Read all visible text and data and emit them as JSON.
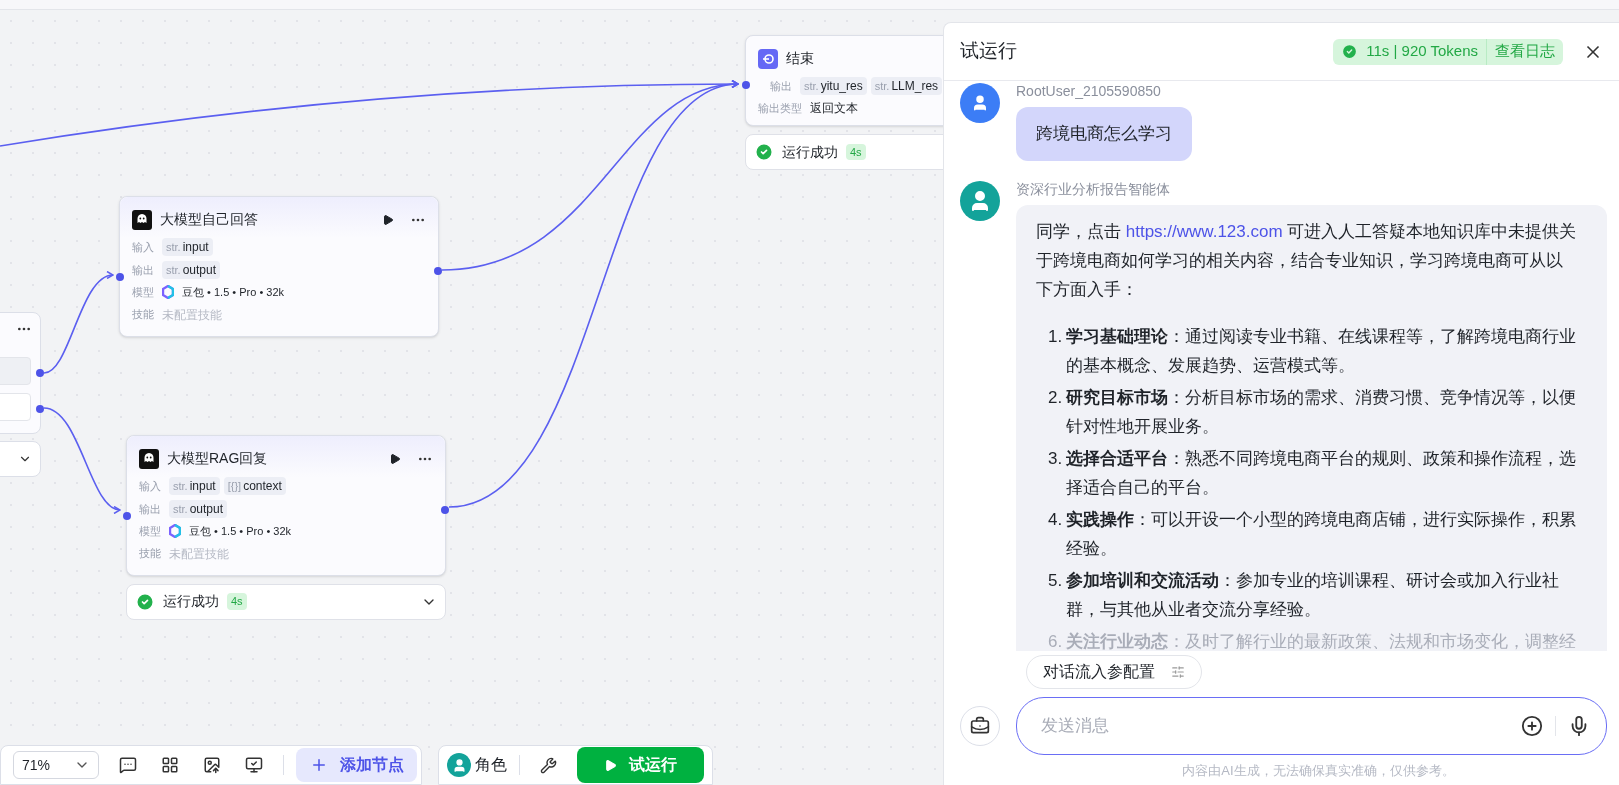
{
  "canvas": {
    "end_node": {
      "title": "结束",
      "output_label": "输出",
      "outputs": [
        {
          "type": "str.",
          "name": "yitu_res"
        },
        {
          "type": "str.",
          "name": "LLM_res"
        }
      ],
      "output_type_label": "输出类型",
      "output_type": "返回文本",
      "status": {
        "text": "运行成功",
        "time": "4s"
      }
    },
    "llm_nodes": [
      {
        "title": "大模型自己回答",
        "rows": [
          {
            "kind": "tags",
            "label": "输入",
            "tags": [
              {
                "type": "str.",
                "name": "input"
              }
            ]
          },
          {
            "kind": "tags",
            "label": "输出",
            "tags": [
              {
                "type": "str.",
                "name": "output"
              }
            ]
          },
          {
            "kind": "model",
            "label": "模型",
            "value": "豆包 • 1.5 • Pro • 32k"
          },
          {
            "kind": "muted",
            "label": "技能",
            "value": "未配置技能"
          }
        ]
      },
      {
        "title": "大模型RAG回复",
        "rows": [
          {
            "kind": "tags",
            "label": "输入",
            "tags": [
              {
                "type": "str.",
                "name": "input"
              },
              {
                "type": "[{}]",
                "name": "context"
              }
            ]
          },
          {
            "kind": "tags",
            "label": "输出",
            "tags": [
              {
                "type": "str.",
                "name": "output"
              }
            ]
          },
          {
            "kind": "model",
            "label": "模型",
            "value": "豆包 • 1.5 • Pro • 32k"
          },
          {
            "kind": "muted",
            "label": "技能",
            "value": "未配置技能"
          }
        ],
        "status": {
          "text": "运行成功",
          "time": "4s"
        }
      }
    ]
  },
  "toolbar": {
    "zoom": "71%",
    "add_node": "添加节点",
    "role": "角色",
    "test_run": "试运行"
  },
  "panel": {
    "title": "试运行",
    "run_stats": "11s | 920 Tokens",
    "view_log": "查看日志",
    "messages": [
      {
        "kind": "user",
        "sender": "RootUser_2105590850",
        "text": "跨境电商怎么学习"
      },
      {
        "kind": "bot",
        "sender": "资深行业分析报告智能体",
        "intro_before": "同学，点击",
        "link": "https://www.123.com",
        "intro_after": "可进入人工答疑本地知识库中未提供关于跨境电商如何学习的相关内容，结合专业知识，学习跨境电商可从以下方面入手：",
        "items": [
          {
            "number": "1.",
            "title": "学习基础理论",
            "text": "：通过阅读专业书籍、在线课程等，了解跨境电商行业的基本概念、发展趋势、运营模式等。",
            "faded": false
          },
          {
            "number": "2.",
            "title": "研究目标市场",
            "text": "：分析目标市场的需求、消费习惯、竞争情况等，以便针对性地开展业务。",
            "faded": false
          },
          {
            "number": "3.",
            "title": "选择合适平台",
            "text": "：熟悉不同跨境电商平台的规则、政策和操作流程，选择适合自己的平台。",
            "faded": false
          },
          {
            "number": "4.",
            "title": "实践操作",
            "text": "：可以开设一个小型的跨境电商店铺，进行实际操作，积累经验。",
            "faded": false
          },
          {
            "number": "5.",
            "title": "参加培训和交流活动",
            "text": "：参加专业的培训课程、研讨会或加入行业社群，与其他从业者交流分享经验。",
            "faded": false
          },
          {
            "number": "6.",
            "title": "关注行业动态",
            "text": "：及时了解行业的最新政策、法规和市场变化，调整经",
            "faded": true
          }
        ]
      }
    ],
    "config_chip": "对话流入参配置",
    "input_placeholder": "发送消息",
    "disclaimer": "内容由AI生成，无法确保真实准确，仅供参考。"
  }
}
